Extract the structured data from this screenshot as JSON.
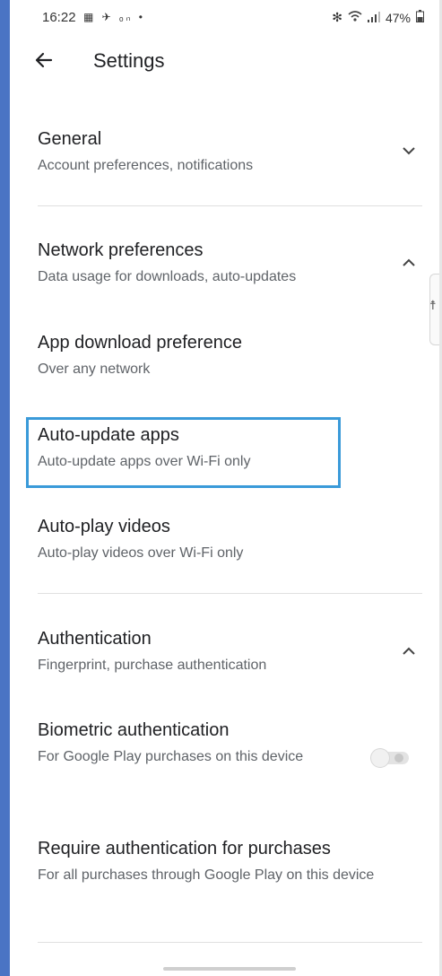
{
  "status_bar": {
    "time": "16:22",
    "notification_icons": "▦ ✈ ₒₙ •",
    "battery": "47%"
  },
  "app_bar": {
    "back_icon": "arrow-left",
    "title": "Settings"
  },
  "sections": {
    "general": {
      "title": "General",
      "subtitle": "Account preferences, notifications",
      "expanded": false
    },
    "network": {
      "title": "Network preferences",
      "subtitle": "Data usage for downloads, auto-updates",
      "expanded": true
    },
    "app_download": {
      "title": "App download preference",
      "subtitle": "Over any network"
    },
    "auto_update": {
      "title": "Auto-update apps",
      "subtitle": "Auto-update apps over Wi-Fi only"
    },
    "auto_play": {
      "title": "Auto-play videos",
      "subtitle": "Auto-play videos over Wi-Fi only"
    },
    "authentication": {
      "title": "Authentication",
      "subtitle": "Fingerprint, purchase authentication",
      "expanded": true
    },
    "biometric": {
      "title": "Biometric authentication",
      "subtitle": "For Google Play purchases on this device",
      "toggle_on": false
    },
    "require_auth": {
      "title": "Require authentication for purchases",
      "subtitle": "For all purchases through Google Play on this device"
    }
  },
  "colors": {
    "highlight": "#3a9ad9",
    "left_edge": "#4a74c4"
  }
}
